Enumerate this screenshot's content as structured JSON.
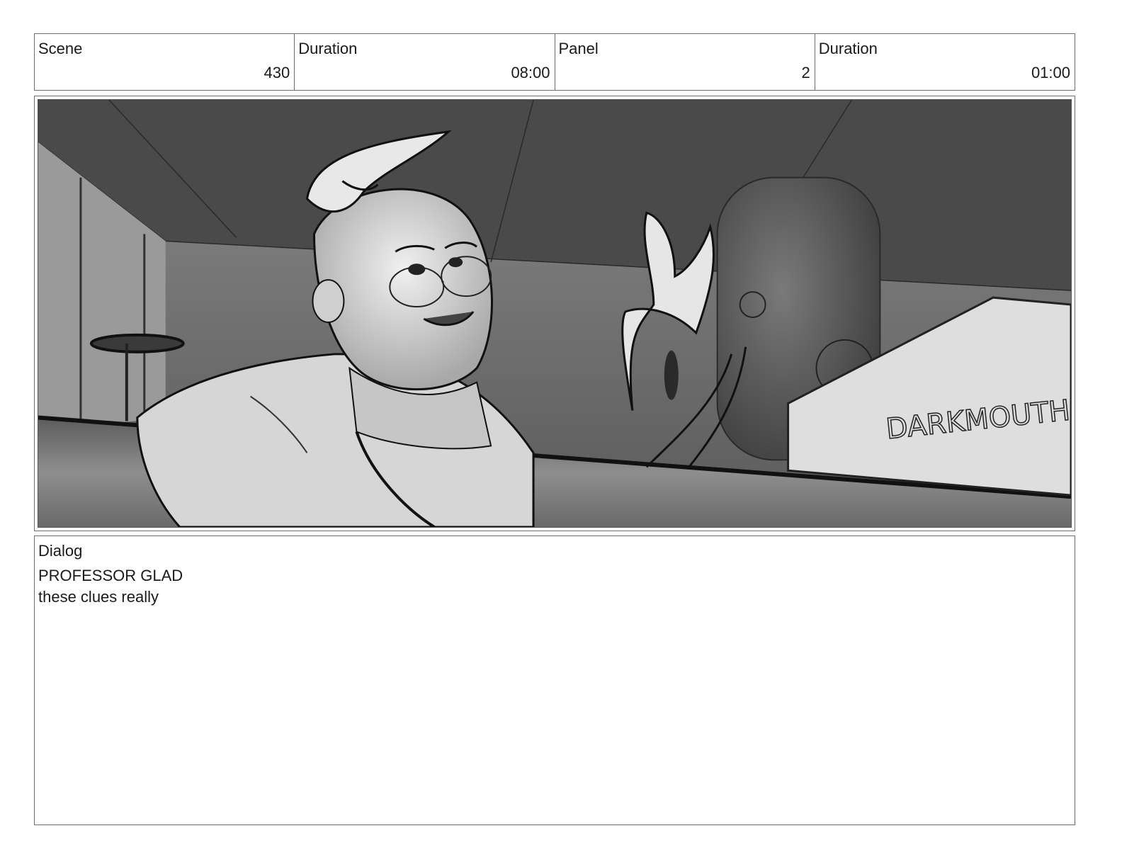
{
  "header": {
    "scene_label": "Scene",
    "scene_value": "430",
    "scene_duration_label": "Duration",
    "scene_duration_value": "08:00",
    "panel_label": "Panel",
    "panel_value": "2",
    "panel_duration_label": "Duration",
    "panel_duration_value": "01:00"
  },
  "panel": {
    "image": "storyboard-sketch-professor-laboratory",
    "sign_text": "DARKMOUTH"
  },
  "dialog": {
    "label": "Dialog",
    "speaker": "PROFESSOR GLAD",
    "line": "these clues really"
  }
}
